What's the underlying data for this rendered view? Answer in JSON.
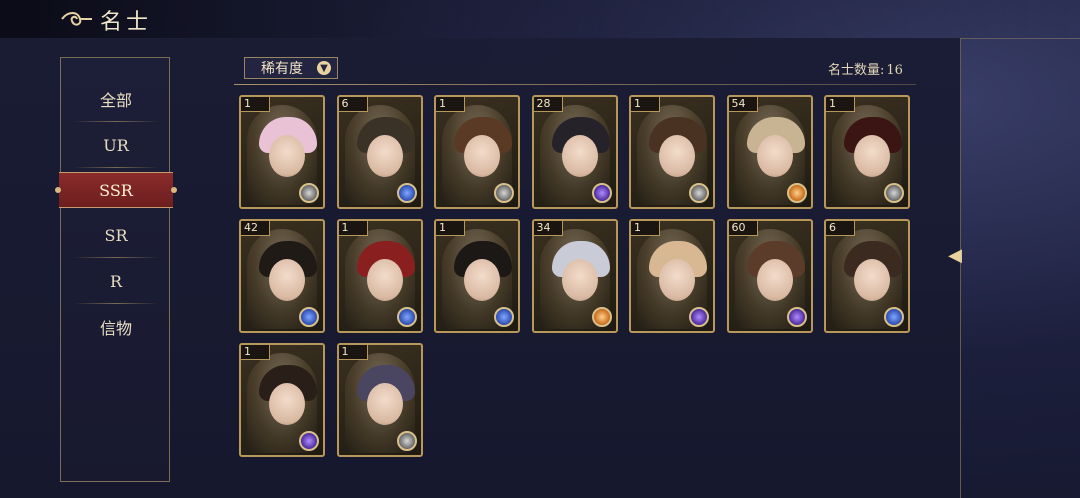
{
  "header": {
    "title": "名士",
    "back_icon": "back-swirl-icon"
  },
  "sidebar": {
    "items": [
      {
        "label": "全部"
      },
      {
        "label": "UR"
      },
      {
        "label": "SSR"
      },
      {
        "label": "SR"
      },
      {
        "label": "R"
      },
      {
        "label": "信物"
      }
    ],
    "active": "SSR",
    "active_color": "#7a2424"
  },
  "filter": {
    "label": "稀有度",
    "icon": "chevron-down-icon"
  },
  "count": {
    "label": "名士数量:",
    "value": "16"
  },
  "cards": [
    {
      "level": "1",
      "hair": "#e9c2d6",
      "badge": "gray"
    },
    {
      "level": "6",
      "hair": "#3a3226",
      "badge": "blue"
    },
    {
      "level": "1",
      "hair": "#5a3a24",
      "badge": "gray"
    },
    {
      "level": "28",
      "hair": "#26222a",
      "badge": "purple"
    },
    {
      "level": "1",
      "hair": "#4a3222",
      "badge": "gray"
    },
    {
      "level": "54",
      "hair": "#c8b392",
      "badge": "orange"
    },
    {
      "level": "1",
      "hair": "#3b1414",
      "badge": "gray"
    },
    {
      "level": "42",
      "hair": "#1f1a16",
      "badge": "blue"
    },
    {
      "level": "1",
      "hair": "#8a1f1f",
      "badge": "blue"
    },
    {
      "level": "1",
      "hair": "#1c1816",
      "badge": "blue"
    },
    {
      "level": "34",
      "hair": "#c9ccd6",
      "badge": "orange"
    },
    {
      "level": "1",
      "hair": "#d8b892",
      "badge": "purple"
    },
    {
      "level": "60",
      "hair": "#5b3b2a",
      "badge": "purple"
    },
    {
      "level": "6",
      "hair": "#3a2a1f",
      "badge": "blue"
    },
    {
      "level": "1",
      "hair": "#2a1e18",
      "badge": "purple"
    },
    {
      "level": "1",
      "hair": "#4a4560",
      "badge": "gray"
    }
  ],
  "nav": {
    "next_icon": "right-arrow-icon"
  }
}
